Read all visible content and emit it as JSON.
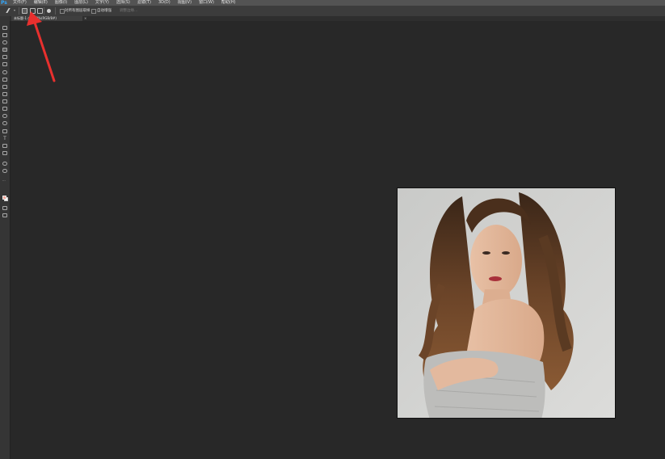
{
  "app": {
    "logo": "Ps"
  },
  "menu": [
    "文件(F)",
    "编辑(E)",
    "图像(I)",
    "图层(L)",
    "文字(Y)",
    "选择(S)",
    "滤镜(T)",
    "3D(D)",
    "视图(V)",
    "窗口(W)",
    "帮助(H)"
  ],
  "options_bar": {
    "sample_all_layers_label": "对所有图层取样",
    "auto_enhance_label": "自动增强",
    "refine_edge_label": "调整边缘..."
  },
  "document_tab": {
    "title": "未标题-1 @ 100%(RGB/8#)",
    "close": "×"
  },
  "tools": {
    "text_tool_glyph": "T"
  },
  "colors": {
    "foreground": "#f3a79b",
    "background": "#ffffff",
    "annotation_arrow": "#e8302e",
    "brand": "#31a8ff"
  }
}
